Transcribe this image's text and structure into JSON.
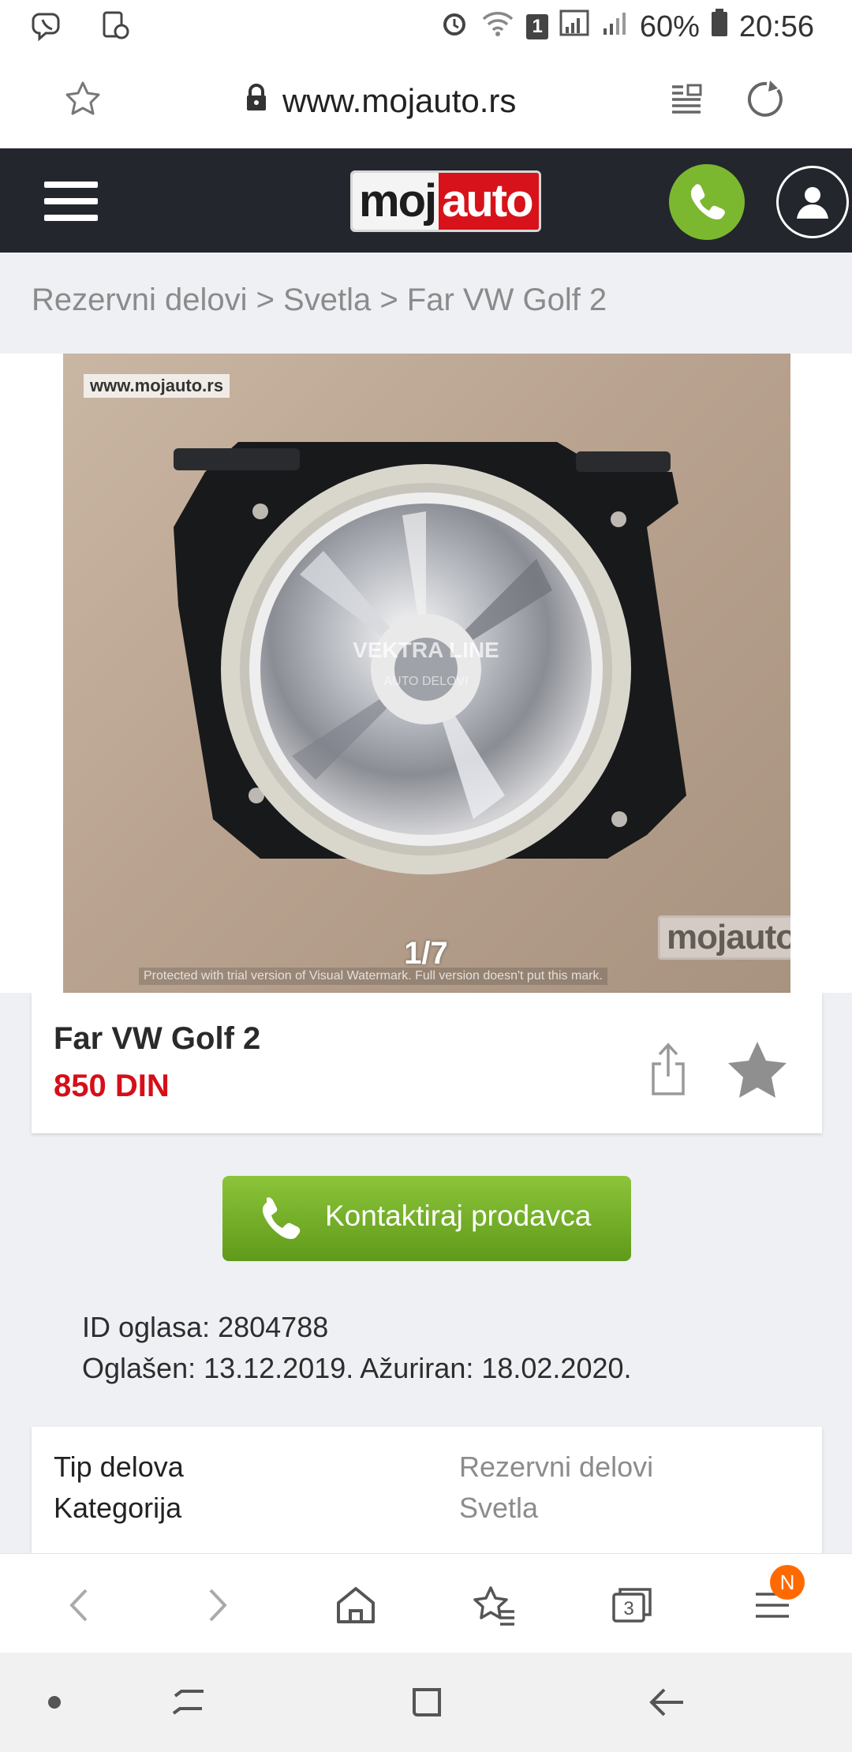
{
  "status_bar": {
    "battery_pct": "60%",
    "time": "20:56",
    "sim_badge": "1"
  },
  "address_bar": {
    "url": "www.mojauto.rs"
  },
  "site_header": {
    "logo_part1": "moj",
    "logo_part2": "auto"
  },
  "breadcrumb": "Rezervni delovi > Svetla > Far VW Golf 2",
  "gallery": {
    "counter": "1/7",
    "watermark_url": "www.mojauto.rs",
    "watermark_logo": "mojauto",
    "lens_text": "VEKTRA LINE",
    "lens_subtext": "AUTO DELOVI",
    "protection_text": "Protected with trial version of Visual Watermark. Full version doesn't put this mark."
  },
  "listing": {
    "title": "Far VW Golf 2",
    "price": "850 DIN"
  },
  "contact_button": {
    "label": "Kontaktiraj prodavca"
  },
  "meta": {
    "id_line": "ID oglasa: 2804788",
    "dates_line": "Oglašen: 13.12.2019. Ažuriran: 18.02.2020."
  },
  "specs": [
    {
      "label": "Tip delova",
      "value": "Rezervni delovi"
    },
    {
      "label": "Kategorija",
      "value": "Svetla"
    }
  ],
  "browser_nav": {
    "tabs_count": "3",
    "menu_badge": "N"
  },
  "colors": {
    "header_bg": "#23262d",
    "accent_green": "#7cb82f",
    "price_red": "#d50f19",
    "badge_orange": "#ff6a00"
  }
}
